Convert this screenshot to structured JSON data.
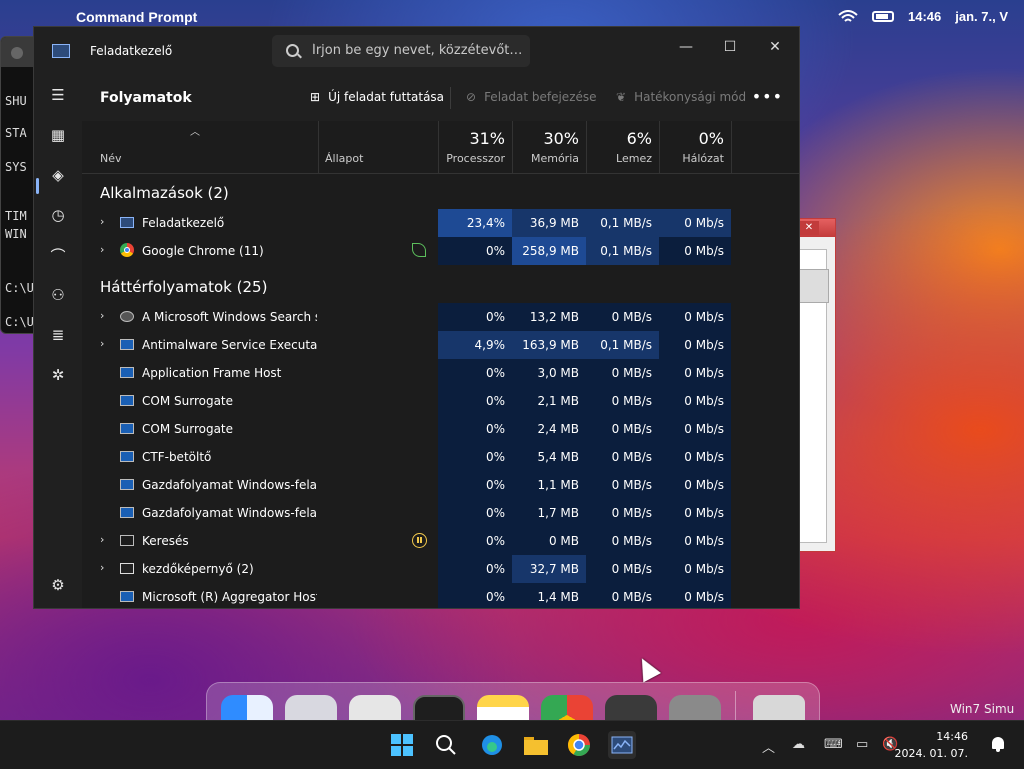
{
  "menubar": {
    "app_name": "Command Prompt",
    "time": "14:46",
    "date": "jan. 7., V"
  },
  "cmd_window": {
    "lines": [
      "SHU",
      "STA",
      "SYS",
      "TIM",
      "WIN",
      "C:\\U",
      "C:\\U"
    ]
  },
  "task_manager": {
    "title": "Feladatkezelő",
    "search_placeholder": "Írjon be egy nevet, közzétevőt…",
    "window_controls": {
      "minimize": "—",
      "maximize": "☐",
      "close": "✕"
    },
    "toolbar": {
      "page_title": "Folyamatok",
      "new_task": "Új feladat futtatása",
      "end_task": "Feladat befejezése",
      "efficiency_mode": "Hatékonysági mód",
      "more": "•••"
    },
    "columns": {
      "name": "Név",
      "status": "Állapot",
      "cpu_pct": "31%",
      "cpu": "Processzor",
      "mem_pct": "30%",
      "mem": "Memória",
      "disk_pct": "6%",
      "disk": "Lemez",
      "net_pct": "0%",
      "net": "Hálózat"
    },
    "groups": {
      "apps": "Alkalmazások (2)",
      "background": "Háttérfolyamatok (25)"
    },
    "apps": [
      {
        "name": "Feladatkezelő",
        "cpu": "23,4%",
        "mem": "36,9 MB",
        "disk": "0,1 MB/s",
        "net": "0 Mb/s"
      },
      {
        "name": "Google Chrome (11)",
        "cpu": "0%",
        "mem": "258,9 MB",
        "disk": "0,1 MB/s",
        "net": "0 Mb/s"
      }
    ],
    "background": [
      {
        "name": "A Microsoft Windows Search s...",
        "cpu": "0%",
        "mem": "13,2 MB",
        "disk": "0 MB/s",
        "net": "0 Mb/s"
      },
      {
        "name": "Antimalware Service Executable",
        "cpu": "4,9%",
        "mem": "163,9 MB",
        "disk": "0,1 MB/s",
        "net": "0 Mb/s"
      },
      {
        "name": "Application Frame Host",
        "cpu": "0%",
        "mem": "3,0 MB",
        "disk": "0 MB/s",
        "net": "0 Mb/s"
      },
      {
        "name": "COM Surrogate",
        "cpu": "0%",
        "mem": "2,1 MB",
        "disk": "0 MB/s",
        "net": "0 Mb/s"
      },
      {
        "name": "COM Surrogate",
        "cpu": "0%",
        "mem": "2,4 MB",
        "disk": "0 MB/s",
        "net": "0 Mb/s"
      },
      {
        "name": "CTF-betöltő",
        "cpu": "0%",
        "mem": "5,4 MB",
        "disk": "0 MB/s",
        "net": "0 Mb/s"
      },
      {
        "name": "Gazdafolyamat Windows-fela...",
        "cpu": "0%",
        "mem": "1,1 MB",
        "disk": "0 MB/s",
        "net": "0 Mb/s"
      },
      {
        "name": "Gazdafolyamat Windows-fela...",
        "cpu": "0%",
        "mem": "1,7 MB",
        "disk": "0 MB/s",
        "net": "0 Mb/s"
      },
      {
        "name": "Keresés",
        "cpu": "0%",
        "mem": "0 MB",
        "disk": "0 MB/s",
        "net": "0 Mb/s"
      },
      {
        "name": "kezdőképernyő (2)",
        "cpu": "0%",
        "mem": "32,7 MB",
        "disk": "0 MB/s",
        "net": "0 Mb/s"
      },
      {
        "name": "Microsoft (R) Aggregator Host",
        "cpu": "0%",
        "mem": "1,4 MB",
        "disk": "0 MB/s",
        "net": "0 Mb/s"
      }
    ]
  },
  "watermark": "Win7 Simu",
  "taskbar": {
    "time": "14:46",
    "date": "2024. 01. 07."
  },
  "colors": {
    "heat_low": "#0b1e3d",
    "heat_mid": "#17366a",
    "heat_high": "#1e4a94",
    "accent": "#8ab4f8"
  }
}
